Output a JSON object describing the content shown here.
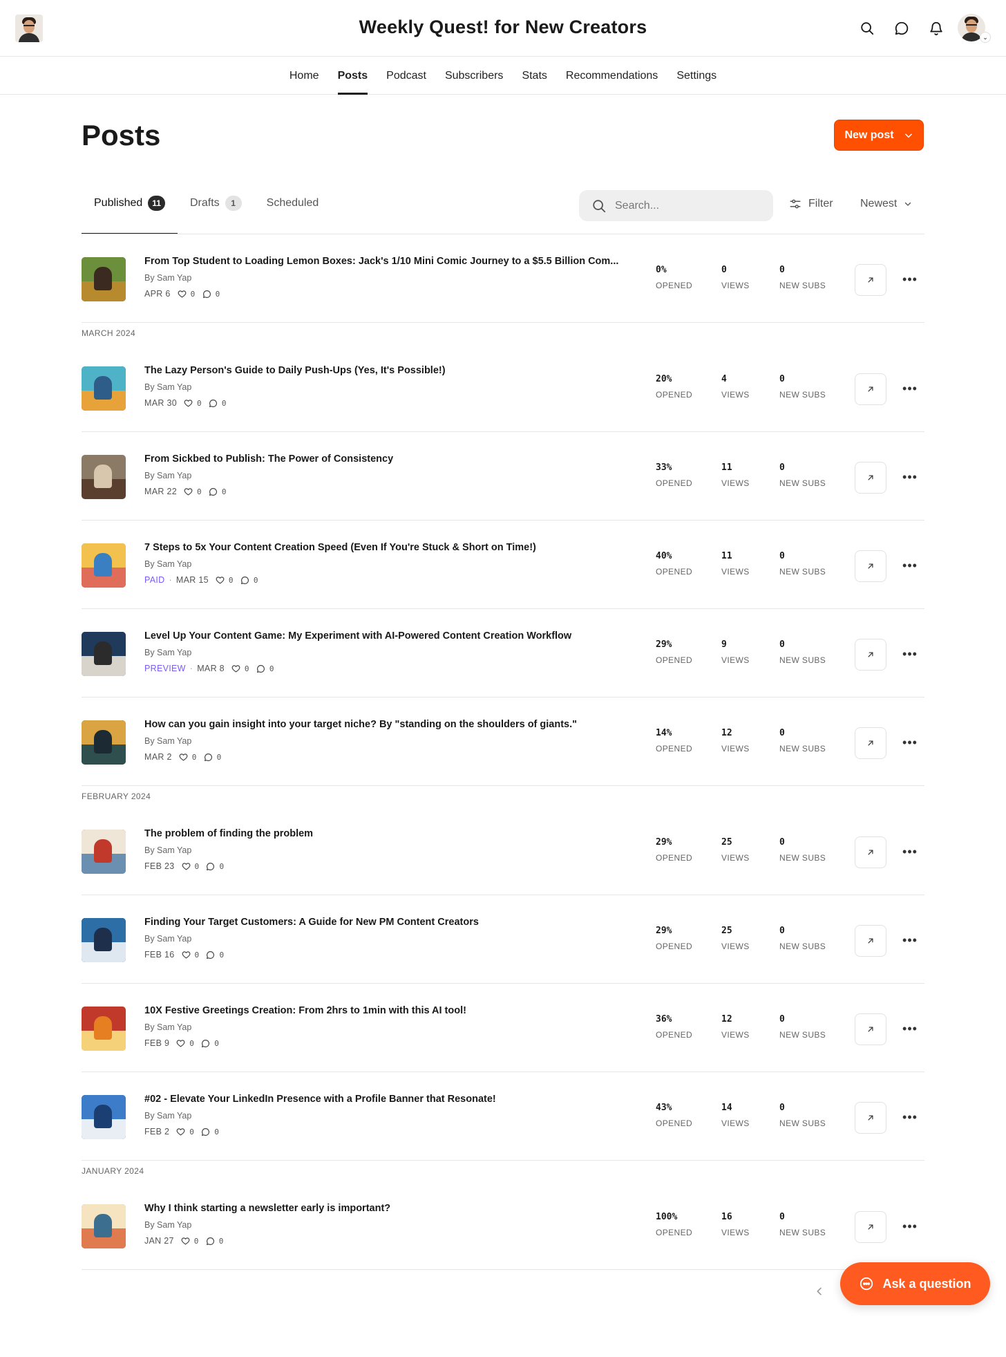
{
  "header": {
    "publication_title": "Weekly Quest! for New Creators"
  },
  "nav": {
    "items": [
      {
        "label": "Home"
      },
      {
        "label": "Posts",
        "active": true
      },
      {
        "label": "Podcast"
      },
      {
        "label": "Subscribers"
      },
      {
        "label": "Stats"
      },
      {
        "label": "Recommendations"
      },
      {
        "label": "Settings"
      }
    ]
  },
  "page": {
    "title": "Posts",
    "new_post_label": "New post"
  },
  "tabs": [
    {
      "label": "Published",
      "count": "11",
      "active": true
    },
    {
      "label": "Drafts",
      "count": "1"
    },
    {
      "label": "Scheduled",
      "count": ""
    }
  ],
  "toolbar": {
    "search_placeholder": "Search...",
    "filter_label": "Filter",
    "sort_label": "Newest"
  },
  "stat_labels": {
    "opened": "OPENED",
    "views": "VIEWS",
    "new_subs": "NEW SUBS"
  },
  "colors": {
    "accent": "#ff4f00",
    "tag": "#7a5af8"
  },
  "groups": [
    {
      "month": "",
      "posts": [
        {
          "title": "From Top Student to Loading Lemon Boxes: Jack's 1/10 Mini Comic Journey to a $5.5 Billion Com...",
          "author": "By Sam Yap",
          "tag": "",
          "date": "APR 6",
          "likes": "0",
          "comments": "0",
          "opened": "0%",
          "views": "0",
          "new_subs": "0",
          "thumb": [
            "#6b8f3a",
            "#b88a2e",
            "#3b2a1f"
          ]
        }
      ]
    },
    {
      "month": "MARCH 2024",
      "posts": [
        {
          "title": "The Lazy Person's Guide to Daily Push-Ups (Yes, It's Possible!)",
          "author": "By Sam Yap",
          "tag": "",
          "date": "MAR 30",
          "likes": "0",
          "comments": "0",
          "opened": "20%",
          "views": "4",
          "new_subs": "0",
          "thumb": [
            "#4fb3c8",
            "#e8a23a",
            "#2f5d8a"
          ]
        },
        {
          "title": "From Sickbed to Publish: The Power of Consistency",
          "author": "By Sam Yap",
          "tag": "",
          "date": "MAR 22",
          "likes": "0",
          "comments": "0",
          "opened": "33%",
          "views": "11",
          "new_subs": "0",
          "thumb": [
            "#8a7a66",
            "#5a3f2e",
            "#d9c7ad"
          ]
        },
        {
          "title": "7 Steps to 5x Your Content Creation Speed (Even If You're Stuck & Short on Time!)",
          "author": "By Sam Yap",
          "tag": "PAID",
          "date": "MAR 15",
          "likes": "0",
          "comments": "0",
          "opened": "40%",
          "views": "11",
          "new_subs": "0",
          "thumb": [
            "#f2c14e",
            "#e06c5a",
            "#3a7fc1"
          ]
        },
        {
          "title": "Level Up Your Content Game: My Experiment with AI-Powered Content Creation Workflow",
          "author": "By Sam Yap",
          "tag": "PREVIEW",
          "date": "MAR 8",
          "likes": "0",
          "comments": "0",
          "opened": "29%",
          "views": "9",
          "new_subs": "0",
          "thumb": [
            "#1f3a5a",
            "#d8d4cc",
            "#2b2b2b"
          ]
        },
        {
          "title": "How can you gain insight into your target niche? By \"standing on the shoulders of giants.\"",
          "author": "By Sam Yap",
          "tag": "",
          "date": "MAR 2",
          "likes": "0",
          "comments": "0",
          "opened": "14%",
          "views": "12",
          "new_subs": "0",
          "thumb": [
            "#d9a441",
            "#2f4f4f",
            "#1c2a33"
          ]
        }
      ]
    },
    {
      "month": "FEBRUARY 2024",
      "posts": [
        {
          "title": "The problem of finding the problem",
          "author": "By Sam Yap",
          "tag": "",
          "date": "FEB 23",
          "likes": "0",
          "comments": "0",
          "opened": "29%",
          "views": "25",
          "new_subs": "0",
          "thumb": [
            "#efe6d8",
            "#6a8fb0",
            "#c0392b"
          ]
        },
        {
          "title": "Finding Your Target Customers: A Guide for New PM Content Creators",
          "author": "By Sam Yap",
          "tag": "",
          "date": "FEB 16",
          "likes": "0",
          "comments": "0",
          "opened": "29%",
          "views": "25",
          "new_subs": "0",
          "thumb": [
            "#2e6ea6",
            "#dfe8f0",
            "#1d2f4a"
          ]
        },
        {
          "title": "10X Festive Greetings Creation: From 2hrs to 1min with this AI tool!",
          "author": "By Sam Yap",
          "tag": "",
          "date": "FEB 9",
          "likes": "0",
          "comments": "0",
          "opened": "36%",
          "views": "12",
          "new_subs": "0",
          "thumb": [
            "#c0392b",
            "#f5d27a",
            "#e67e22"
          ]
        },
        {
          "title": "#02 - Elevate Your LinkedIn Presence with a Profile Banner that Resonate!",
          "author": "By Sam Yap",
          "tag": "",
          "date": "FEB 2",
          "likes": "0",
          "comments": "0",
          "opened": "43%",
          "views": "14",
          "new_subs": "0",
          "thumb": [
            "#3d7cc9",
            "#e9eef4",
            "#1b3f73"
          ]
        }
      ]
    },
    {
      "month": "JANUARY 2024",
      "posts": [
        {
          "title": "Why I think starting a newsletter early is important?",
          "author": "By Sam Yap",
          "tag": "",
          "date": "JAN 27",
          "likes": "0",
          "comments": "0",
          "opened": "100%",
          "views": "16",
          "new_subs": "0",
          "thumb": [
            "#f6e3c0",
            "#e07a4f",
            "#3c6e8f"
          ]
        }
      ]
    }
  ],
  "footer": {
    "ask_label": "Ask a question"
  }
}
